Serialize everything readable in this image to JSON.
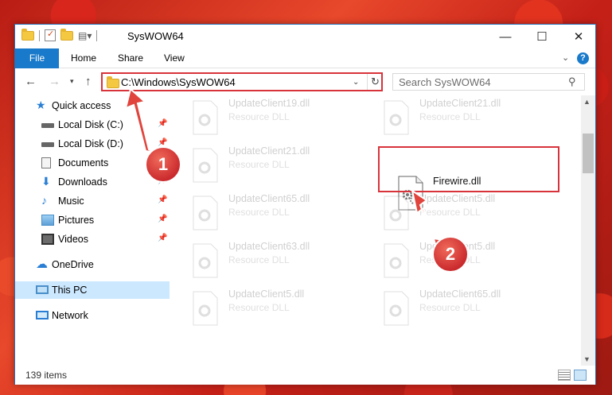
{
  "window": {
    "title": "SysWOW64",
    "controls": {
      "minimize": "—",
      "maximize": "☐",
      "close": "✕"
    }
  },
  "ribbon": {
    "tabs": [
      "File",
      "Home",
      "Share",
      "View"
    ],
    "help": "?"
  },
  "navigation": {
    "back": "←",
    "forward": "→",
    "recent": "▾",
    "up": "↑",
    "address": "C:\\Windows\\SysWOW64",
    "search_placeholder": "Search SysWOW64"
  },
  "sidebar": {
    "items": [
      {
        "label": "Quick access",
        "icon": "star-icon"
      },
      {
        "label": "Local Disk (C:)",
        "icon": "drive-icon",
        "pinned": true
      },
      {
        "label": "Local Disk (D:)",
        "icon": "drive-icon",
        "pinned": true
      },
      {
        "label": "Documents",
        "icon": "documents-icon",
        "pinned": true
      },
      {
        "label": "Downloads",
        "icon": "download-icon",
        "pinned": true
      },
      {
        "label": "Music",
        "icon": "music-icon",
        "pinned": true
      },
      {
        "label": "Pictures",
        "icon": "pictures-icon",
        "pinned": true
      },
      {
        "label": "Videos",
        "icon": "videos-icon",
        "pinned": true
      },
      {
        "label": "OneDrive",
        "icon": "cloud-icon"
      },
      {
        "label": "This PC",
        "icon": "computer-icon",
        "selected": true
      },
      {
        "label": "Network",
        "icon": "network-icon"
      }
    ]
  },
  "files": [
    {
      "name": "UpdateClient19.dll",
      "type": "Resource DLL"
    },
    {
      "name": "UpdateClient21.dll",
      "type": "Resource DLL"
    },
    {
      "name": "UpdateClient21.dll",
      "type": "Resource DLL"
    },
    {
      "name": "Firewire.dll",
      "type": "",
      "selected": true
    },
    {
      "name": "UpdateClient65.dll",
      "type": "Resource DLL"
    },
    {
      "name": "UpdateClient5.dll",
      "type": "Resource DLL"
    },
    {
      "name": "UpdateClient63.dll",
      "type": "Resource DLL"
    },
    {
      "name": "UpdateClient5.dll",
      "type": "Resource DLL"
    },
    {
      "name": "UpdateClient5.dll",
      "type": "Resource DLL"
    },
    {
      "name": "UpdateClient65.dll",
      "type": "Resource DLL"
    }
  ],
  "status": {
    "item_count": "139 items"
  },
  "callouts": [
    {
      "number": "1"
    },
    {
      "number": "2"
    }
  ],
  "colors": {
    "accent": "#1979ca",
    "highlight": "#d8333a",
    "selection": "#cce8ff"
  }
}
